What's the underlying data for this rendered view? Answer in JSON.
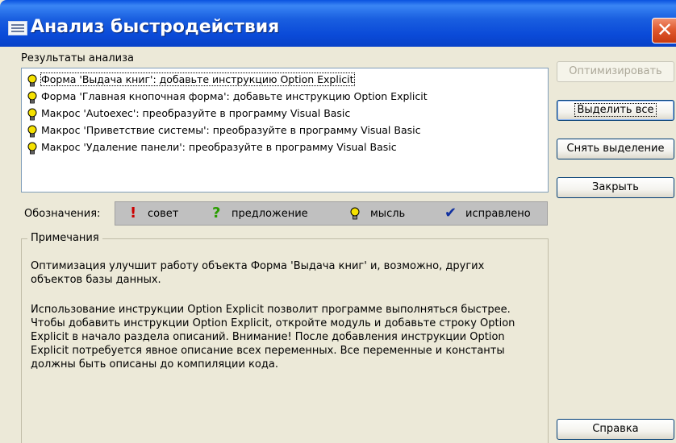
{
  "window": {
    "title": "Анализ быстродействия",
    "close_label": "✕"
  },
  "results": {
    "label": "Результаты анализа",
    "items": [
      {
        "icon": "idea-bulb-icon",
        "text": "Форма 'Выдача книг': добавьте инструкцию Option Explicit"
      },
      {
        "icon": "idea-bulb-icon",
        "text": "Форма 'Главная кнопочная форма': добавьте инструкцию Option Explicit"
      },
      {
        "icon": "idea-bulb-icon",
        "text": "Макрос 'Autoexec': преобразуйте в программу Visual Basic"
      },
      {
        "icon": "idea-bulb-icon",
        "text": "Макрос 'Приветствие системы': преобразуйте в программу Visual Basic"
      },
      {
        "icon": "idea-bulb-icon",
        "text": "Макрос 'Удаление панели': преобразуйте в программу Visual Basic"
      }
    ]
  },
  "legend": {
    "label": "Обозначения:",
    "entries": [
      {
        "symbol": "!",
        "text": "совет",
        "color": "#cc0000"
      },
      {
        "symbol": "?",
        "text": "предложение",
        "color": "#2a9d00"
      },
      {
        "symbol": "bulb",
        "text": "мысль",
        "color": "#d8c000"
      },
      {
        "symbol": "✔",
        "text": "исправлено",
        "color": "#1030a0"
      }
    ]
  },
  "notes": {
    "label": "Примечания",
    "paragraph1": "Оптимизация улучшит работу объекта Форма 'Выдача книг' и, возможно, других объектов базы данных.",
    "paragraph2": "Использование инструкции Option Explicit позволит программе выполняться быстрее. Чтобы добавить инструкции Option Explicit, откройте модуль и добавьте строку Option Explicit в начало раздела описаний. Внимание! После добавления инструкции Option Explicit потребуется явное описание всех переменных. Все переменные и константы должны быть описаны до компиляции кода."
  },
  "buttons": {
    "optimize": "Оптимизировать",
    "select_all": "Выделить все",
    "deselect": "Снять выделение",
    "close": "Закрыть",
    "help": "Справка"
  },
  "colors": {
    "titlebar": "#0a4ad8",
    "window_bg": "#ece9d8",
    "legend_bg": "#c0c0c0"
  }
}
